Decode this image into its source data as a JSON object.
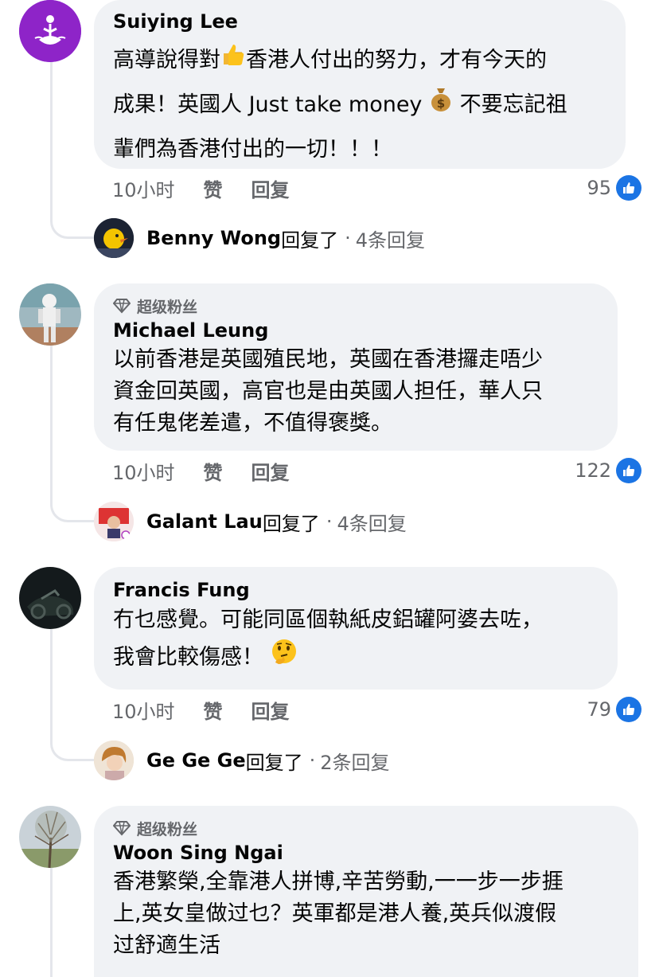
{
  "comments": [
    {
      "author": "Suiying Lee",
      "text_parts": [
        "高導說得對",
        "香港人付出的努力，才有今天的\n成果！英國人 Just take money ",
        " 不要忘記祖\n輩們為香港付出的一切！！！"
      ],
      "time": "10小时",
      "like_label": "赞",
      "reply_label": "回复",
      "reactions": "95",
      "reply_summary": {
        "name": "Benny Wong",
        "text": "回复了",
        "count": "4条回复"
      }
    },
    {
      "badge": "超级粉丝",
      "author": "Michael Leung",
      "text": "以前香港是英國殖民地，英國在香港攞走唔少\n資金回英國，高官也是由英國人担任，華人只\n有任鬼佬差遣，不值得褒獎。",
      "time": "10小时",
      "like_label": "赞",
      "reply_label": "回复",
      "reactions": "122",
      "reply_summary": {
        "name": "Galant Lau",
        "text": "回复了",
        "count": "4条回复"
      }
    },
    {
      "author": "Francis Fung",
      "text_parts": [
        "冇乜感覺。可能同區個執紙皮鋁罐阿婆去咗，\n我會比較傷感！ "
      ],
      "time": "10小时",
      "like_label": "赞",
      "reply_label": "回复",
      "reactions": "79",
      "reply_summary": {
        "name": "Ge Ge Ge",
        "text": "回复了",
        "count": "2条回复"
      }
    },
    {
      "badge": "超级粉丝",
      "author": "Woon Sing Ngai",
      "text": "香港繁榮,全靠港人拼博,辛苦勞動,一一步一步捱\n上,英女皇做过乜？英軍都是港人養,英兵似渡假\n过舒適生活"
    }
  ],
  "icons": {
    "thumbs_up": "thumbs-up-emoji",
    "money_bag": "money-bag-emoji",
    "thinking": "thinking-face-emoji",
    "diamond": "diamond-icon",
    "like": "like-reaction-icon"
  },
  "colors": {
    "like_blue": "#1b74e4",
    "bubble": "#f0f2f5",
    "muted": "#65676b",
    "thread": "#e4e6eb"
  }
}
